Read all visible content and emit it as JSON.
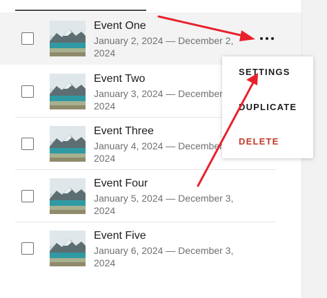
{
  "events": [
    {
      "title": "Event One",
      "dates": "January 2, 2024 — December 2, 2024"
    },
    {
      "title": "Event Two",
      "dates": "January 3, 2024 — December 3, 2024"
    },
    {
      "title": "Event Three",
      "dates": "January 4, 2024 — December 4, 2024"
    },
    {
      "title": "Event Four",
      "dates": "January 5, 2024 — December 3, 2024"
    },
    {
      "title": "Event Five",
      "dates": "January 6, 2024 — December 3, 2024"
    }
  ],
  "menu": {
    "settings": "SETTINGS",
    "duplicate": "DUPLICATE",
    "delete": "DELETE"
  },
  "colors": {
    "annotation_arrow": "#e8212b",
    "delete_text": "#c0392b",
    "highlight_row": "#f3f3f3"
  },
  "icons": {
    "more": "more-options-icon",
    "thumbnail": "landscape-image"
  }
}
